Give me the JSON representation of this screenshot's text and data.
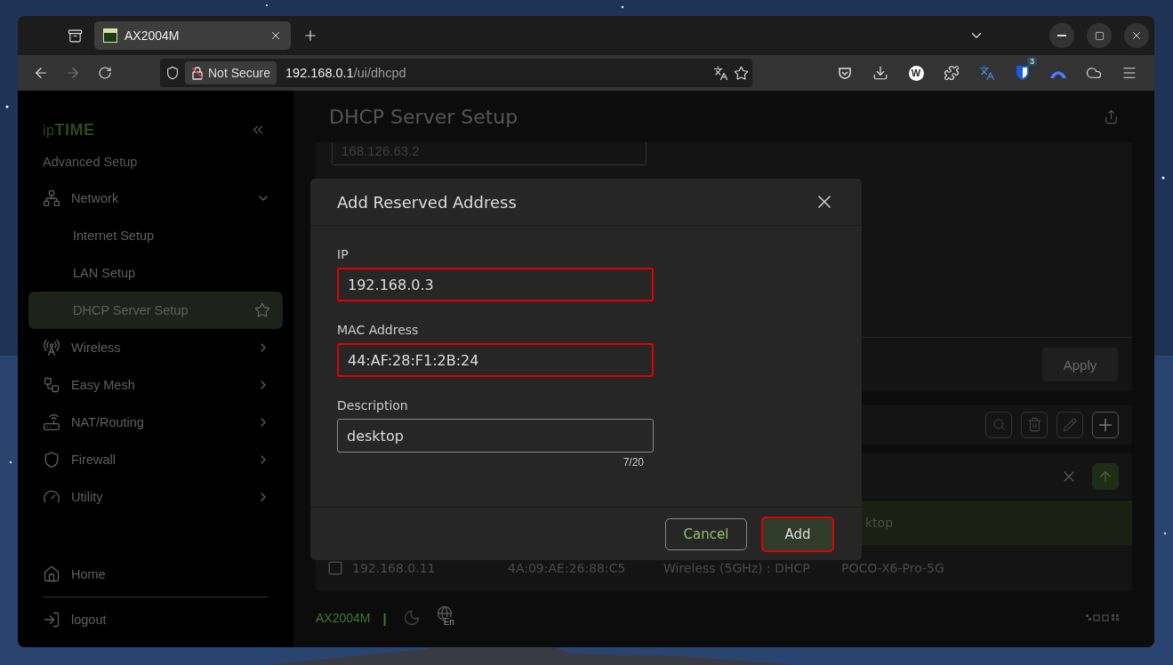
{
  "browser": {
    "tabs": [
      {
        "title": "AX2004M",
        "selected": true
      }
    ],
    "security_label": "Not Secure",
    "url_host": "192.168.0.1",
    "url_path": "/ui/dhcpd",
    "profile_letter": "W",
    "extension_badge": "3"
  },
  "sidebar": {
    "brand_prefix": "ip",
    "brand": "TIME",
    "section": "Advanced Setup",
    "items": [
      {
        "label": "Network",
        "expanded": true,
        "children": [
          {
            "label": "Internet Setup",
            "selected": false
          },
          {
            "label": "LAN Setup",
            "selected": false
          },
          {
            "label": "DHCP Server Setup",
            "selected": true
          }
        ]
      },
      {
        "label": "Wireless",
        "expanded": false
      },
      {
        "label": "Easy Mesh",
        "expanded": false
      },
      {
        "label": "NAT/Routing",
        "expanded": false
      },
      {
        "label": "Firewall",
        "expanded": false
      },
      {
        "label": "Utility",
        "expanded": false
      }
    ],
    "bottom": [
      "Home",
      "logout"
    ]
  },
  "page": {
    "title": "DHCP Server Setup",
    "dns_value": "168.126.63.2",
    "apply_button": {
      "label": "Apply",
      "disabled": true
    },
    "rows": [
      {
        "selected": true,
        "cells": [
          "",
          "",
          "",
          "ktop"
        ]
      },
      {
        "selected": false,
        "checked": false,
        "cells": [
          "192.168.0.11",
          "4A:09:AE:26:88:C5",
          "Wireless (5GHz) : DHCP",
          "POCO-X6-Pro-5G"
        ]
      }
    ]
  },
  "footer": {
    "model": "AX2004M",
    "separator": "|",
    "language": "En"
  },
  "dialog": {
    "title": "Add Reserved Address",
    "fields": [
      {
        "label": "IP",
        "value": "192.168.0.3",
        "highlighted": true
      },
      {
        "label": "MAC Address",
        "value": "44:AF:28:F1:2B:24",
        "highlighted": true
      },
      {
        "label": "Description",
        "value": "desktop",
        "counter": "7/20",
        "highlighted": false
      }
    ],
    "buttons": [
      {
        "label": "Cancel",
        "kind": "secondary",
        "highlighted": false
      },
      {
        "label": "Add",
        "kind": "primary",
        "highlighted": true
      }
    ]
  }
}
